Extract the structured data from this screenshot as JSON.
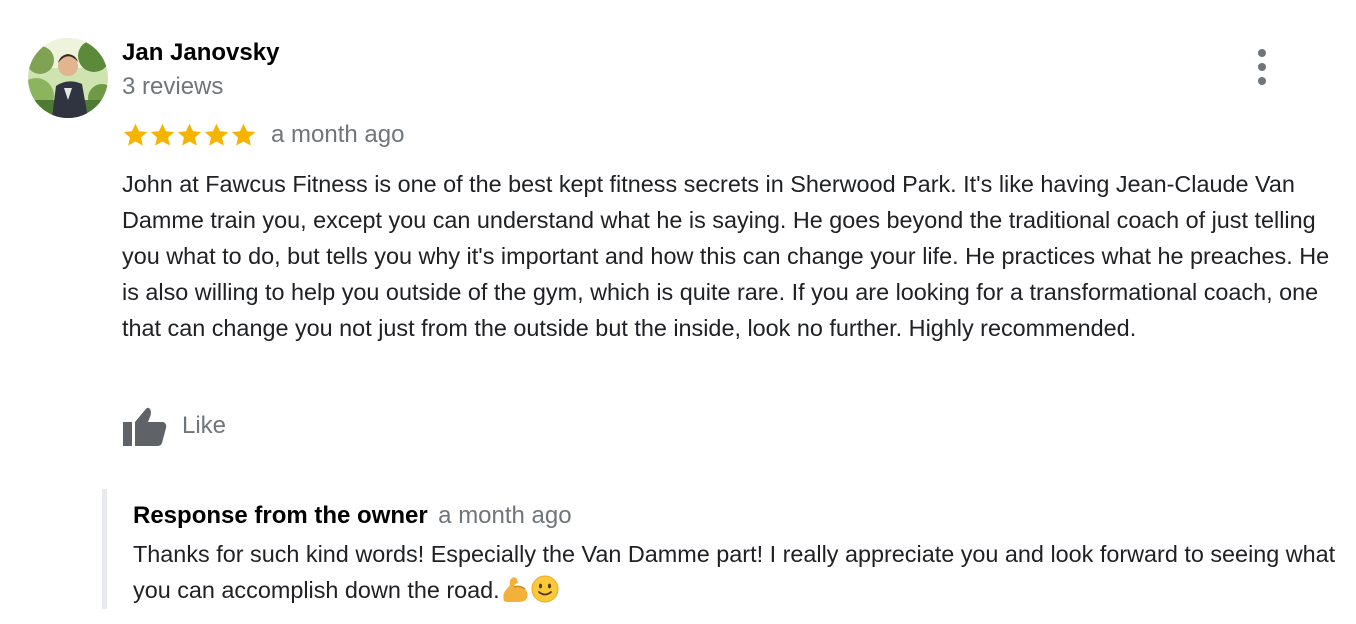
{
  "review": {
    "reviewer": {
      "name": "Jan Janovsky",
      "review_count": "3 reviews",
      "avatar_icon": "profile-photo"
    },
    "rating": {
      "stars": 5,
      "max_stars": 5,
      "star_color": "#f4b400"
    },
    "date": "a month ago",
    "text": "John at Fawcus Fitness is one of the best kept fitness secrets in Sherwood Park. It's like having Jean-Claude Van Damme train you, except you can understand what he is saying. He goes beyond the traditional coach of just telling you what to do, but tells you why it's important and how this can change your life. He practices what he preaches. He is also willing to help you outside of the gym, which is quite rare. If you are looking for a transformational coach, one that can change you not just from the outside but the inside, look no further. Highly recommended.",
    "actions": {
      "like_label": "Like",
      "like_icon": "thumbs-up-icon",
      "menu_icon": "more-vert-icon"
    }
  },
  "owner_response": {
    "title": "Response from the owner",
    "date": "a month ago",
    "text": "Thanks for such kind words! Especially the Van Damme part! I really appreciate you and look forward to seeing what you can accomplish down the road.",
    "emojis": [
      "flexed-biceps-icon",
      "slightly-smiling-face-icon"
    ]
  },
  "colors": {
    "secondary_text": "#70757a",
    "primary_text": "#202124",
    "accent_star": "#f4b400",
    "response_border": "#e8eaed"
  }
}
